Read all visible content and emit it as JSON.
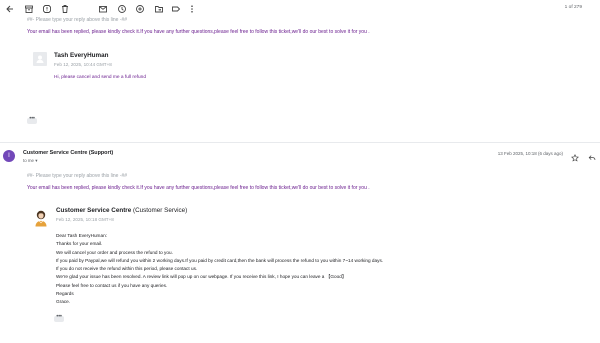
{
  "toolbar": {
    "counter": "1 of 279",
    "icons": [
      "back-arrow-icon",
      "archive-icon",
      "report-spam-icon",
      "delete-icon",
      "mark-unread-icon",
      "snooze-icon",
      "add-task-icon",
      "move-to-icon",
      "label-icon",
      "more-icon"
    ]
  },
  "quoted": {
    "reply_marker": "##- Please type your reply above this line -##",
    "notice": "Your email has been replied, please kindly check it.If you have any further questions,please feel free to follow this ticket,we'll do our best to solve it for you .",
    "author": "Tash EveryHuman",
    "date": "Feb 12, 2025, 10:44 GMT+8",
    "body": "Hi, please cancel and send me a full refund"
  },
  "message": {
    "avatar_initial": "I",
    "sender": "Customer Service Centre (Support)",
    "to": "to me",
    "date": "13 Feb 2025, 10:18 (6 days ago)",
    "reply_marker": "##- Please type your reply above this line -##",
    "notice": "Your email has been replied, please kindly check it.If you have any further questions,please feel free to follow this ticket,we'll do our best to solve it for you .",
    "reply_author": "Customer Service Centre",
    "reply_author_role": "(Customer Service)",
    "reply_date": "Feb 12, 2025, 10:18 GMT+8",
    "reply_lines": [
      "Dear Tash EveryHuman:",
      "Thanks for your email.",
      "We will cancel your order and process the refund to you.",
      "If you paid by Paypal,we will refund you within 2 working days.If you paid by credit card,then the bank will process the refund to you within 7~14 working days.",
      "If you do not receive the refund within this period, please contact us.",
      "We're glad your issue has been resolved. A review link will pop up on our webpage. If you receive this link, I hope you can leave a 【Good】",
      "Please feel free to contact us if you have any queries.",
      "Regards",
      "Grace."
    ]
  },
  "colors": {
    "purple_text": "#6b1f8f",
    "avatar": "#7248b9"
  }
}
